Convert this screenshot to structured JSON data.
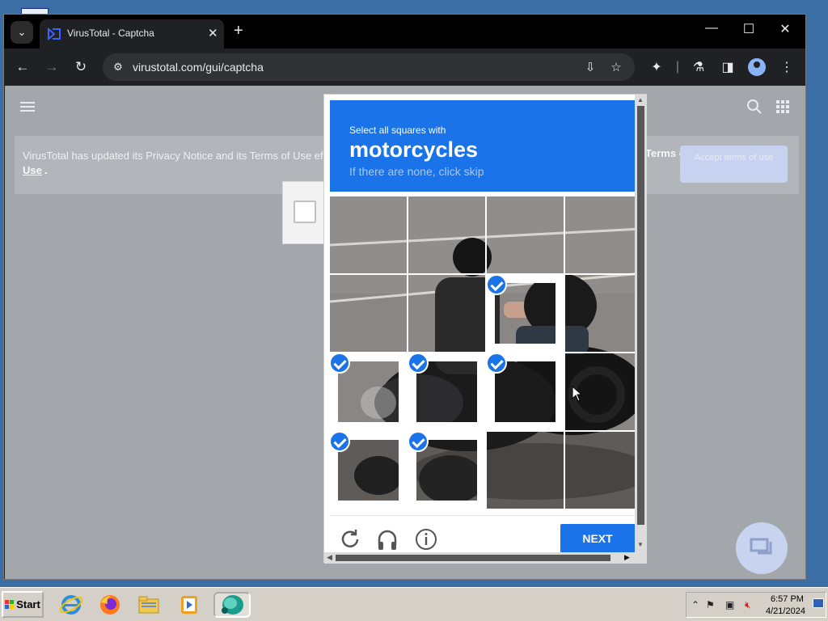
{
  "tab": {
    "title": "VirusTotal - Captcha",
    "close": "✕",
    "new": "+"
  },
  "window_controls": {
    "minimize": "—",
    "maximize": "☐",
    "close": "✕"
  },
  "nav": {
    "back": "←",
    "forward": "→",
    "reload": "↻"
  },
  "address": {
    "url": "virustotal.com/gui/captcha"
  },
  "notice": {
    "text": "VirusTotal has updated its Privacy Notice and its Terms of Use eff",
    "link": "Terms of",
    "link2": "Use",
    "suffix": ".",
    "accept": "Accept terms of use"
  },
  "captcha": {
    "instruction": "Select all squares with",
    "target": "motorcycles",
    "hint": "If there are none, click skip",
    "next": "NEXT",
    "tiles": [
      {
        "selected": false
      },
      {
        "selected": false
      },
      {
        "selected": false
      },
      {
        "selected": false
      },
      {
        "selected": false
      },
      {
        "selected": false
      },
      {
        "selected": true
      },
      {
        "selected": false
      },
      {
        "selected": true
      },
      {
        "selected": true
      },
      {
        "selected": true
      },
      {
        "selected": false
      },
      {
        "selected": true
      },
      {
        "selected": true
      },
      {
        "selected": false
      },
      {
        "selected": false
      }
    ]
  },
  "taskbar": {
    "start": "Start",
    "time": "6:57 PM",
    "date": "4/21/2024"
  },
  "colors": {
    "accent": "#1a73e8",
    "overlay": "#a3a6ab"
  }
}
